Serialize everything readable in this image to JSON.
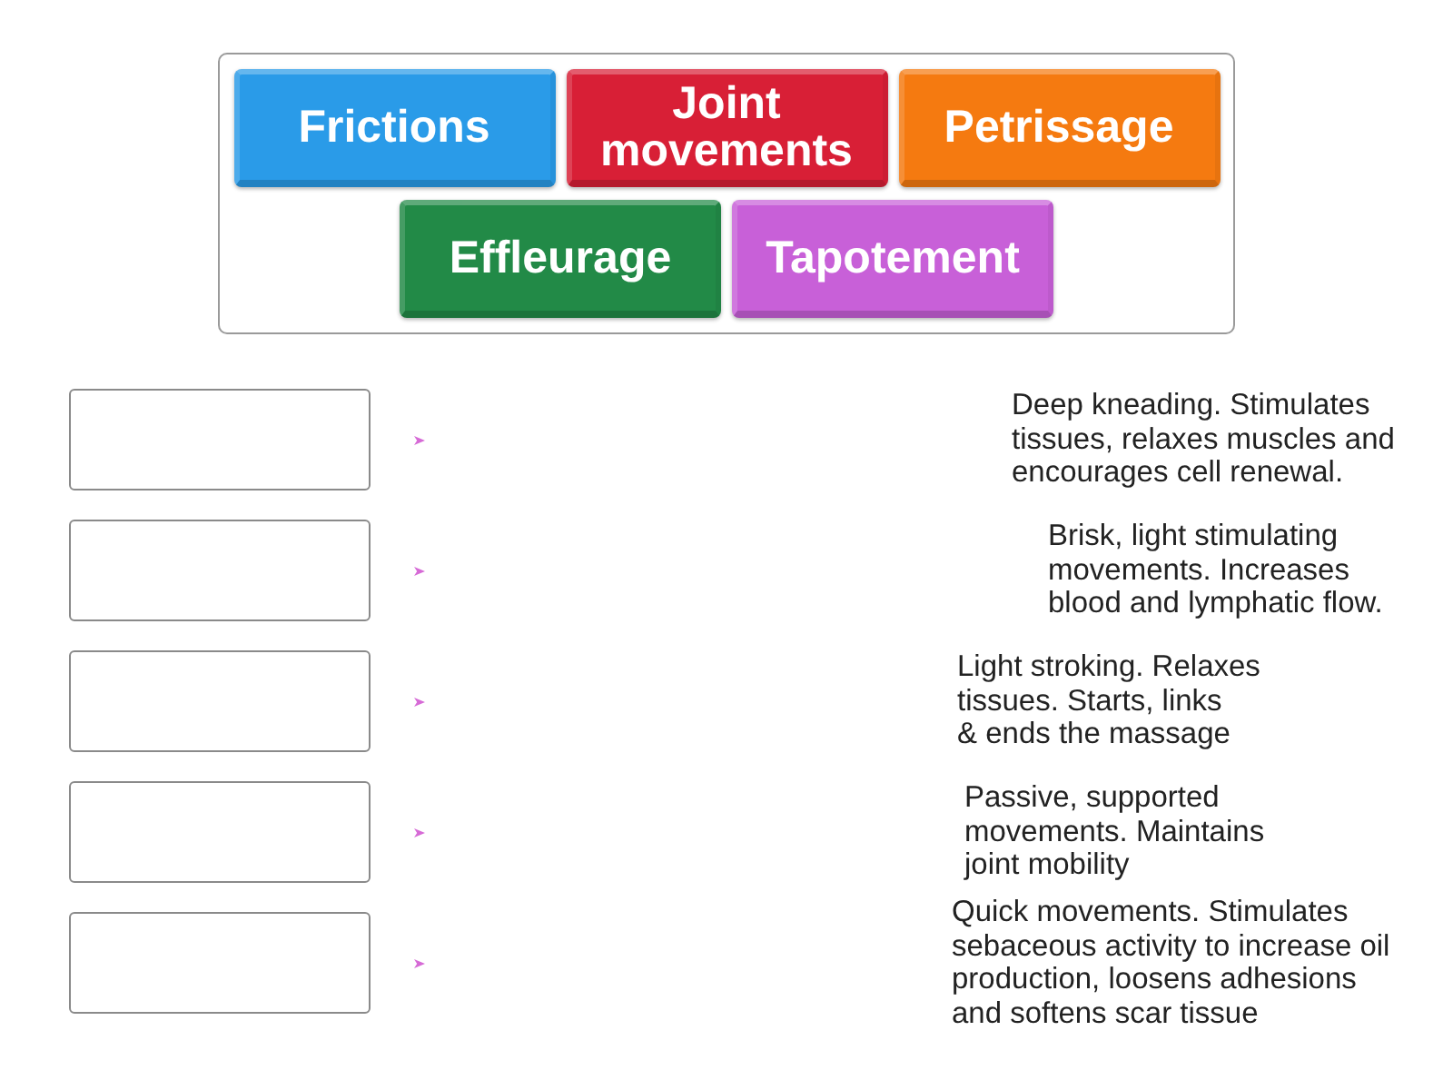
{
  "tiles": [
    {
      "label": "Frictions",
      "color": "#2a9be8"
    },
    {
      "label": "Joint movements",
      "color": "#d81f36"
    },
    {
      "label": "Petrissage",
      "color": "#f57a10"
    },
    {
      "label": "Effleurage",
      "color": "#228a47"
    },
    {
      "label": "Tapotement",
      "color": "#c860d8"
    }
  ],
  "rows": [
    {
      "description": "Deep kneading. Stimulates\ntissues, relaxes muscles and\nencourages cell renewal."
    },
    {
      "description": "Brisk, light stimulating\nmovements. Increases\nblood and lymphatic flow."
    },
    {
      "description": "Light stroking. Relaxes\ntissues. Starts, links\n& ends the massage"
    },
    {
      "description": "Passive, supported\nmovements. Maintains\njoint mobility"
    },
    {
      "description": "Quick movements. Stimulates\nsebaceous activity to increase oil\nproduction, loosens adhesions\nand softens scar tissue"
    }
  ]
}
